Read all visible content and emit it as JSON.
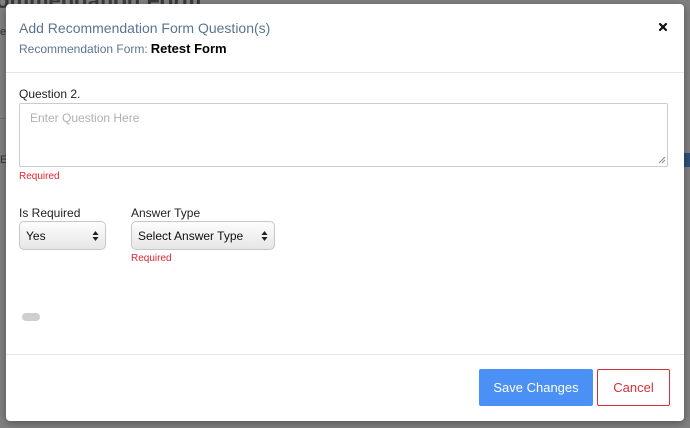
{
  "background": {
    "page_title": "ommendation Form",
    "fragment_top": "e",
    "fragment_mid": "E"
  },
  "modal": {
    "title": "Add Recommendation Form Question(s)",
    "subtitle_label": "Recommendation Form:",
    "form_name": "Retest Form",
    "close_icon": "close-icon"
  },
  "question": {
    "label": "Question 2.",
    "placeholder": "Enter Question Here",
    "value": "",
    "error": "Required"
  },
  "is_required": {
    "label": "Is Required",
    "selected": "Yes"
  },
  "answer_type": {
    "label": "Answer Type",
    "selected": "Select Answer Type",
    "error": "Required"
  },
  "footer": {
    "save_label": "Save Changes",
    "cancel_label": "Cancel"
  },
  "colors": {
    "accent": "#4a90f5",
    "danger": "#d4323a",
    "title": "#5b7590"
  }
}
